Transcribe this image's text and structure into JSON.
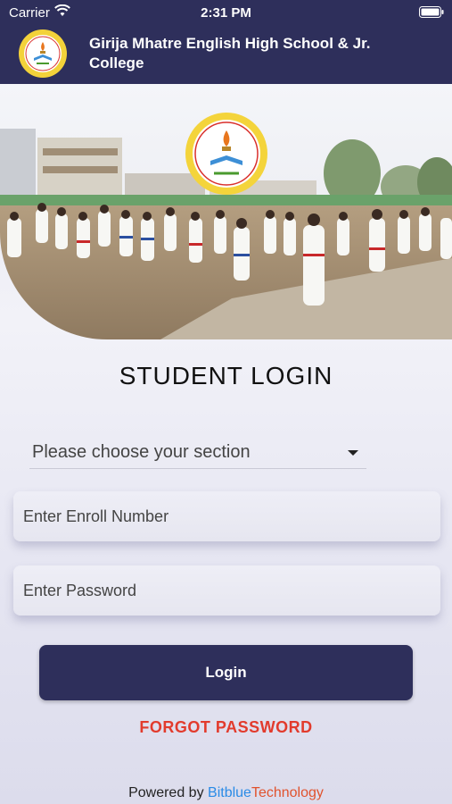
{
  "status_bar": {
    "carrier": "Carrier",
    "time": "2:31 PM",
    "wifi_icon": "wifi-icon",
    "battery_icon": "battery-icon"
  },
  "header": {
    "title": "Girija Mhatre English High School & Jr. College",
    "logo_icon": "school-crest-logo",
    "background": "#2e2f5b"
  },
  "banner": {
    "image": "karate-students-photo",
    "emblem": "school-crest-logo"
  },
  "login": {
    "heading": "STUDENT LOGIN",
    "section_select": {
      "placeholder": "Please choose your section"
    },
    "enroll_field": {
      "placeholder": "Enter Enroll Number"
    },
    "password_field": {
      "placeholder": "Enter Password"
    },
    "login_button": "Login",
    "forgot_password": "FORGOT PASSWORD"
  },
  "footer": {
    "powered_prefix": "Powered by",
    "brand_part1": "Bitblue",
    "brand_part2": "Technology"
  },
  "colors": {
    "primary": "#2e2f5b",
    "forgot": "#e23b2d",
    "brand_blue": "#2a8be6",
    "brand_orange": "#e0532e"
  }
}
